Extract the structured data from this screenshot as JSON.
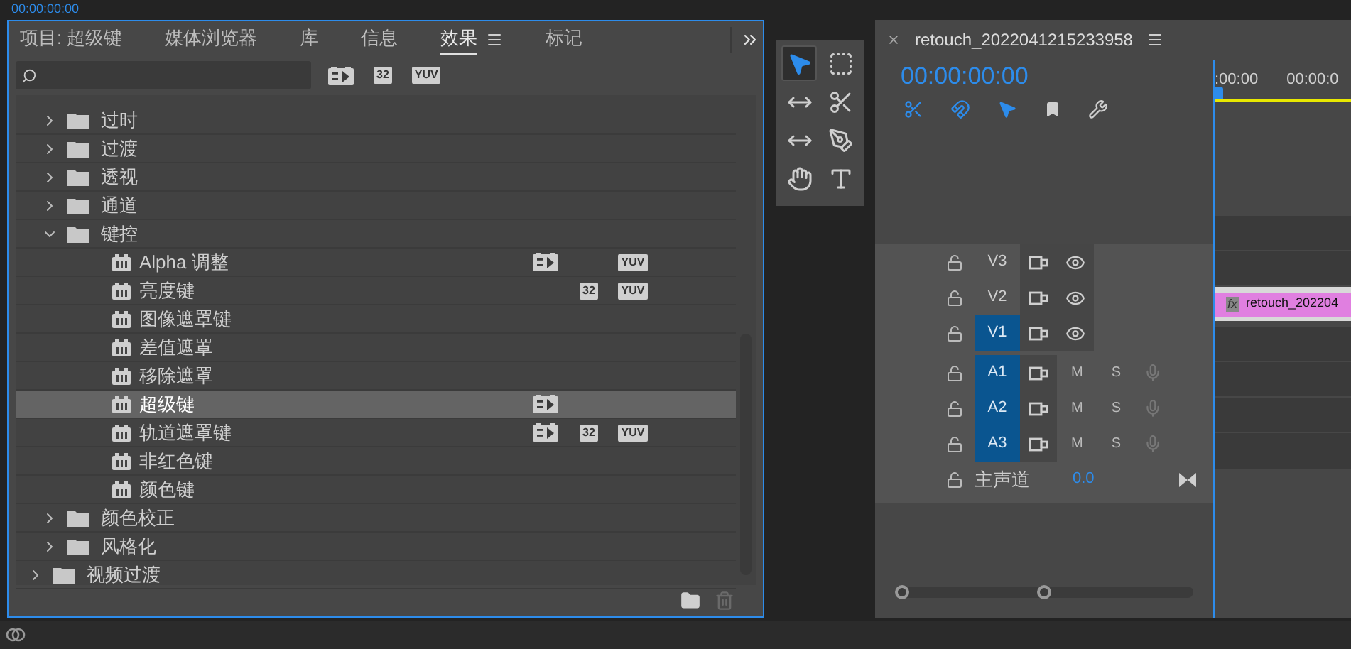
{
  "top_bar": {
    "timecode": "00:00:00:00"
  },
  "effects_panel": {
    "tabs": [
      {
        "label": "项目: 超级键",
        "selected": false,
        "menu": false
      },
      {
        "label": "媒体浏览器",
        "selected": false,
        "menu": false
      },
      {
        "label": "库",
        "selected": false,
        "menu": false
      },
      {
        "label": "信息",
        "selected": false,
        "menu": false
      },
      {
        "label": "效果",
        "selected": true,
        "menu": true
      },
      {
        "label": "标记",
        "selected": false,
        "menu": false
      }
    ],
    "filters": [
      {
        "kind": "accelerated"
      },
      {
        "kind": "bitdepth",
        "label": "32"
      },
      {
        "kind": "yuv",
        "label": "YUV"
      }
    ],
    "tree": [
      {
        "children": [
          {
            "kind": "folder",
            "label": "过时",
            "expanded": false,
            "selected": false
          },
          {
            "kind": "folder",
            "label": "过渡",
            "expanded": false,
            "selected": false
          },
          {
            "kind": "folder",
            "label": "透视",
            "expanded": false,
            "selected": false
          },
          {
            "kind": "folder",
            "label": "通道",
            "expanded": false,
            "selected": false
          },
          {
            "kind": "folder",
            "label": "键控",
            "expanded": true,
            "selected": false,
            "children": [
              {
                "kind": "effect",
                "label": "Alpha 调整",
                "selected": false,
                "badges": [
                  {
                    "kind": "accelerated"
                  },
                  {
                    "kind": "yuv",
                    "label": "YUV"
                  }
                ]
              },
              {
                "kind": "effect",
                "label": "亮度键",
                "selected": false,
                "badges": [
                  {
                    "kind": "bitdepth",
                    "label": "32"
                  },
                  {
                    "kind": "yuv",
                    "label": "YUV"
                  }
                ]
              },
              {
                "kind": "effect",
                "label": "图像遮罩键",
                "selected": false
              },
              {
                "kind": "effect",
                "label": "差值遮罩",
                "selected": false
              },
              {
                "kind": "effect",
                "label": "移除遮罩",
                "selected": false
              },
              {
                "kind": "effect",
                "label": "超级键",
                "selected": true,
                "badges": [
                  {
                    "kind": "accelerated"
                  }
                ]
              },
              {
                "kind": "effect",
                "label": "轨道遮罩键",
                "selected": false,
                "badges": [
                  {
                    "kind": "accelerated"
                  },
                  {
                    "kind": "bitdepth",
                    "label": "32"
                  },
                  {
                    "kind": "yuv",
                    "label": "YUV"
                  }
                ]
              },
              {
                "kind": "effect",
                "label": "非红色键",
                "selected": false
              },
              {
                "kind": "effect",
                "label": "颜色键",
                "selected": false
              }
            ]
          },
          {
            "kind": "folder",
            "label": "颜色校正",
            "expanded": false,
            "selected": false
          },
          {
            "kind": "folder",
            "label": "风格化",
            "expanded": false,
            "selected": false
          }
        ]
      },
      {
        "kind": "folder",
        "label": "视频过渡",
        "expanded": false,
        "selected": false
      }
    ]
  },
  "tools": [
    {
      "kind": "selection",
      "selected": true
    },
    {
      "kind": "track-select",
      "selected": false
    },
    {
      "kind": "ripple",
      "selected": false
    },
    {
      "kind": "razor",
      "selected": false
    },
    {
      "kind": "slip",
      "selected": false
    },
    {
      "kind": "pen",
      "selected": false
    },
    {
      "kind": "hand",
      "selected": false
    },
    {
      "kind": "type",
      "selected": false
    }
  ],
  "timeline": {
    "title": "retouch_2022041215233958",
    "timecode": "00:00:00:00",
    "ruler_labels": [
      ":00:00",
      "00:00:0"
    ],
    "tracks": [
      {
        "kind": "video",
        "label": "V3",
        "targeted": false
      },
      {
        "kind": "video",
        "label": "V2",
        "targeted": false
      },
      {
        "kind": "video",
        "label": "V1",
        "targeted": true,
        "clip": {
          "badge": "fx",
          "label": "retouch_202204"
        }
      },
      {
        "kind": "audio",
        "label": "A1",
        "targeted": true,
        "mute": "M",
        "solo": "S"
      },
      {
        "kind": "audio",
        "label": "A2",
        "targeted": true,
        "mute": "M",
        "solo": "S"
      },
      {
        "kind": "audio",
        "label": "A3",
        "targeted": true,
        "mute": "M",
        "solo": "S"
      }
    ],
    "master": {
      "label": "主声道",
      "value": "0.0"
    }
  }
}
